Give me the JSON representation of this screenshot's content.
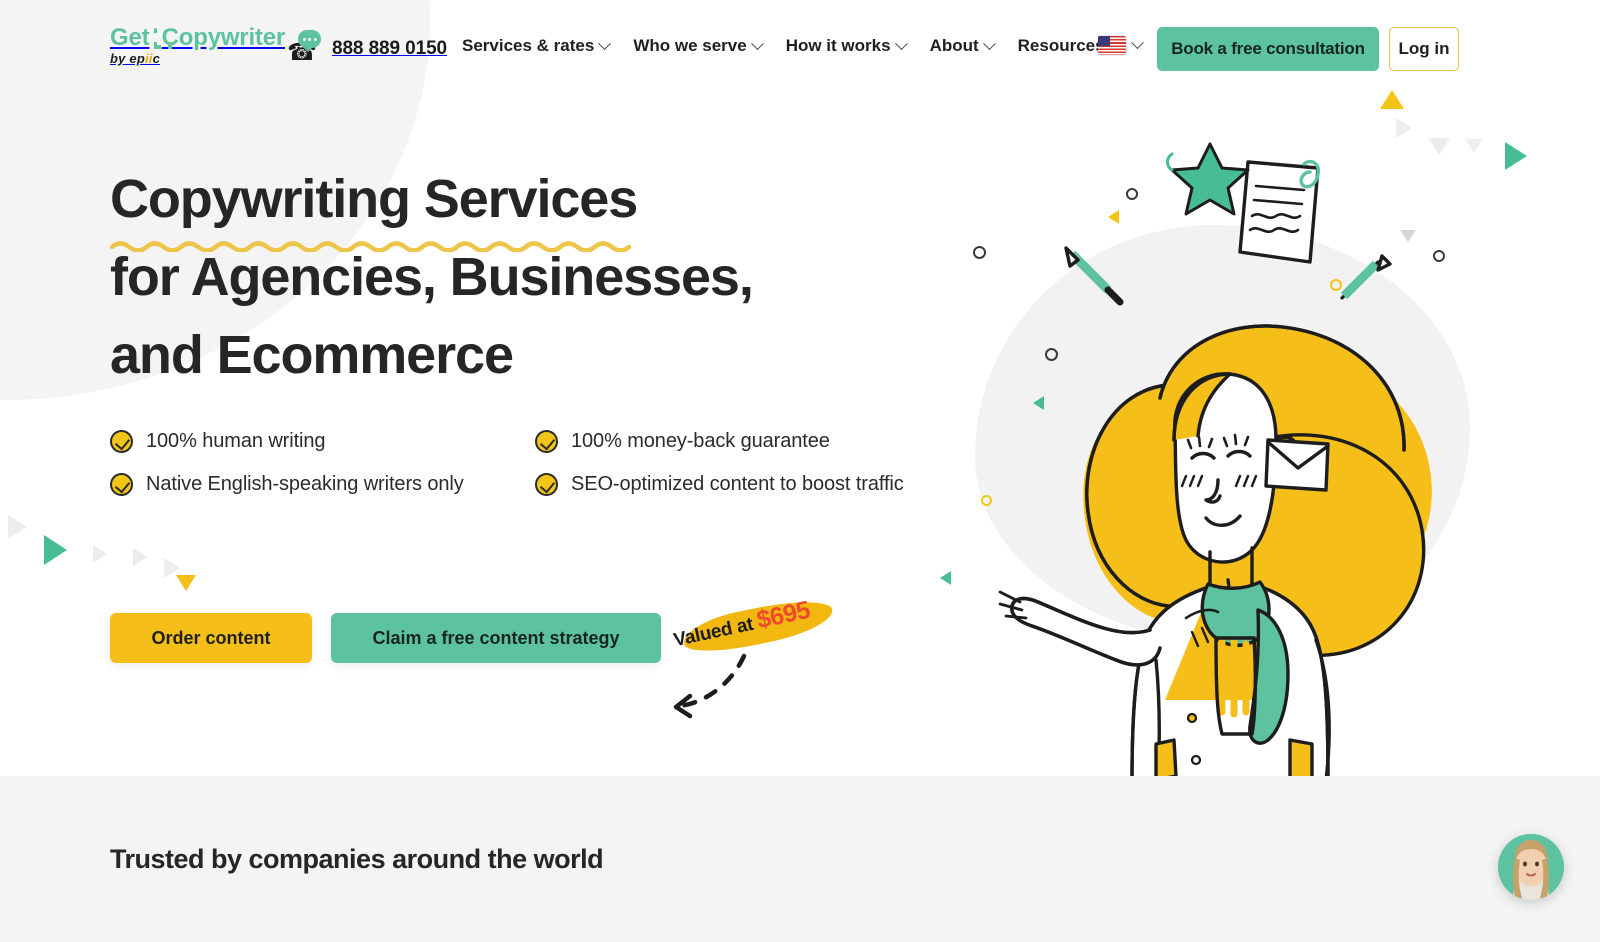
{
  "brand": {
    "logo_line1_a": "Get",
    "logo_letter": "A",
    "logo_line1_b": "Copywriter",
    "logo_line2_pre": "by ep",
    "logo_line2_ii": "ii",
    "logo_line2_post": "c",
    "accent_green": "#5DC2A0",
    "accent_yellow": "#F5BE18",
    "accent_orange": "#EE4B2B"
  },
  "header": {
    "phone": "888 889 0150",
    "phone_icon": "phone-chat-icon",
    "nav": [
      {
        "label": "Services & rates",
        "has_dropdown": true
      },
      {
        "label": "Who we serve",
        "has_dropdown": true
      },
      {
        "label": "How it works",
        "has_dropdown": true
      },
      {
        "label": "About",
        "has_dropdown": true
      },
      {
        "label": "Resources",
        "has_dropdown": true
      }
    ],
    "language": {
      "flag": "us-flag-icon",
      "code": "US"
    },
    "consult_button": "Book a free consultation",
    "login_button": "Log in"
  },
  "hero": {
    "headline_line1": "Copywriting Services",
    "headline_line2": "for Agencies, Businesses,",
    "headline_line3": "and Ecommerce",
    "features": [
      "100% human writing",
      "100% money-back guarantee",
      "Native English-speaking writers only",
      "SEO-optimized content to boost traffic"
    ],
    "primary_cta": "Order content",
    "secondary_cta": "Claim a free content strategy",
    "badge_text": "Valued at",
    "badge_price": "$695"
  },
  "trusted": {
    "title": "Trusted by companies around the world"
  },
  "chat": {
    "avatar_alt": "support-agent-avatar"
  }
}
